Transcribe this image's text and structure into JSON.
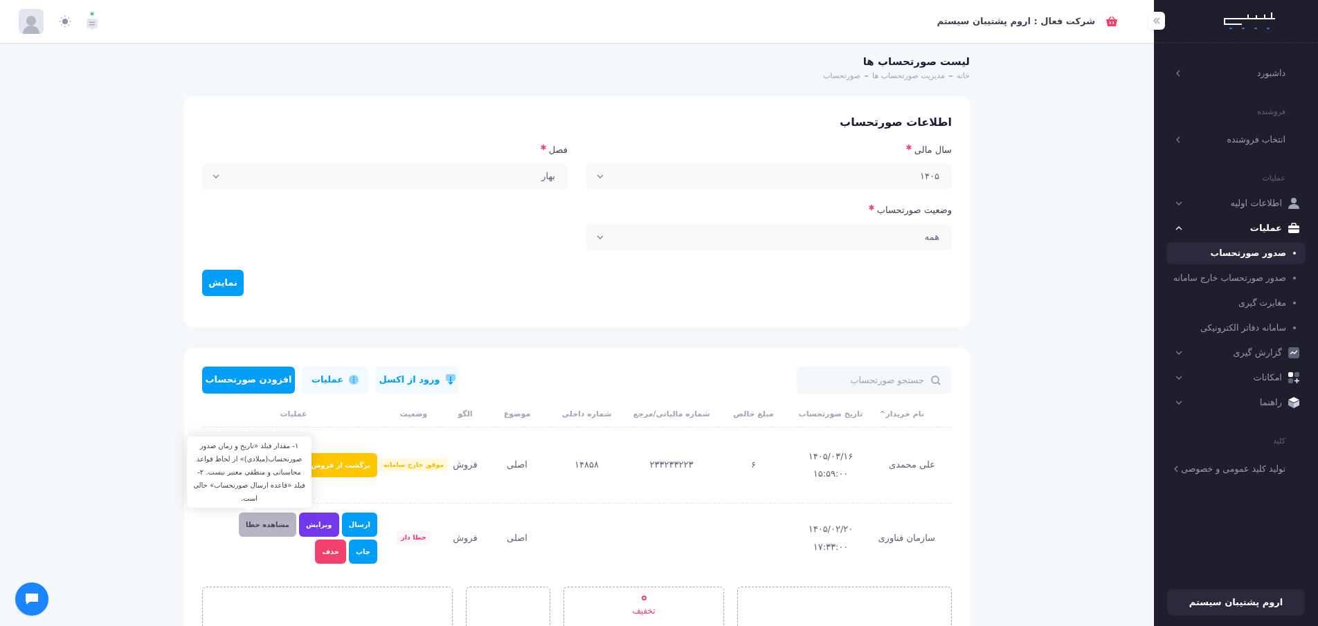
{
  "header": {
    "company": "شرکت فعال : اروم پشتیبان سیستم"
  },
  "sidebar": {
    "items": [
      {
        "kind": "link",
        "label": "داشبورد"
      },
      {
        "kind": "section",
        "label": "فروشنده"
      },
      {
        "kind": "link",
        "label": "انتخاب فروشنده"
      },
      {
        "kind": "section",
        "label": "عملیات"
      },
      {
        "kind": "group",
        "label": "اطلاعات اولیه",
        "expanded": false
      },
      {
        "kind": "group",
        "label": "عملیات",
        "expanded": true,
        "children": [
          {
            "label": "صدور صورتحساب",
            "selected": true
          },
          {
            "label": "صدور صورتحساب خارج سامانه",
            "selected": false
          },
          {
            "label": "مغایرت گیری",
            "selected": false
          },
          {
            "label": "سامانه دفاتر الکترونیکی",
            "selected": false
          }
        ]
      },
      {
        "kind": "group",
        "label": "گزارش گیری",
        "expanded": false
      },
      {
        "kind": "group",
        "label": "امکانات",
        "expanded": false
      },
      {
        "kind": "group",
        "label": "راهنما",
        "expanded": false
      },
      {
        "kind": "section",
        "label": "کلید"
      },
      {
        "kind": "link",
        "label": "تولید کلید عمومی و خصوصی"
      }
    ],
    "footer_button": "اروم پشتیبان سیستم"
  },
  "page": {
    "title": "لیست صورتحساب ها",
    "breadcrumb": [
      "خانه",
      "مدیریت صورتحساب ها",
      "صورتحساب"
    ]
  },
  "filter_card": {
    "title": "اطلاعات صورتحساب",
    "fields": [
      {
        "label": "سال مالی",
        "required": true,
        "value": "۱۴۰۵"
      },
      {
        "label": "فصل",
        "required": true,
        "value": "بهار"
      },
      {
        "label": "وضعیت صورتحساب",
        "required": true,
        "value": "همه"
      }
    ],
    "button": "نمایش"
  },
  "list_card": {
    "search": {
      "placeholder": "جستجو صورتحساب"
    },
    "buttons": [
      {
        "kind": "excel",
        "label": "ورود از اکسل"
      },
      {
        "kind": "menu",
        "label": "عملیات"
      },
      {
        "kind": "add",
        "label": "افزودن صورتحساب"
      }
    ],
    "table": {
      "columns": [
        "نام خریدار^",
        "تاریخ صورتحساب",
        "مبلغ خالص",
        "شماره مالیاتی/مرجع",
        "شماره داخلی",
        "موضوع",
        "الگو",
        "وضعیت",
        "عملیات"
      ],
      "rows": [
        {
          "buyer": "علی محمدی",
          "date": "۱۴۰۵/۰۳/۱۶",
          "time": "۱۵:۵۹:۰۰",
          "net_amount": "۶",
          "tax_number": "۲۳۳۲۳۳۲۲۳",
          "internal_number": "۱۴۸۵۸",
          "subject": "اصلی",
          "pattern": "فروش",
          "status": {
            "label": "موفق خارج سامانه",
            "kind": "warning"
          },
          "actions": [
            {
              "label": "برگشت از فروش",
              "kind": "warning"
            }
          ]
        },
        {
          "buyer": "سازمان فناوری",
          "date": "۱۴۰۵/۰۲/۲۰",
          "time": "۱۷:۳۳:۰۰",
          "subject": "اصلی",
          "pattern": "فروش",
          "status": {
            "label": "خطا دار",
            "kind": "danger"
          },
          "actions": [
            {
              "label": "ارسال",
              "kind": "primary"
            },
            {
              "label": "ویرایش",
              "kind": "purple"
            },
            {
              "label": "مشاهده خطا",
              "kind": "secondary"
            },
            {
              "label": "چاپ",
              "kind": "primary"
            },
            {
              "label": "حذف",
              "kind": "danger"
            }
          ]
        }
      ]
    },
    "tooltip": "۱- مقدار فیلد «تاریخ و زمان صدور صورتحساب(میلادی)» از لحاظ قواعد محاسباتی و منطقی معتبر نیست. ۲- فیلد «قاعده ارسال صورتحساب» خالی است.",
    "summary_boxes": [
      {
        "kind": "blank"
      },
      {
        "kind": "labeled",
        "label": "تخفیف"
      },
      {
        "kind": "blank"
      },
      {
        "kind": "blank"
      }
    ]
  }
}
